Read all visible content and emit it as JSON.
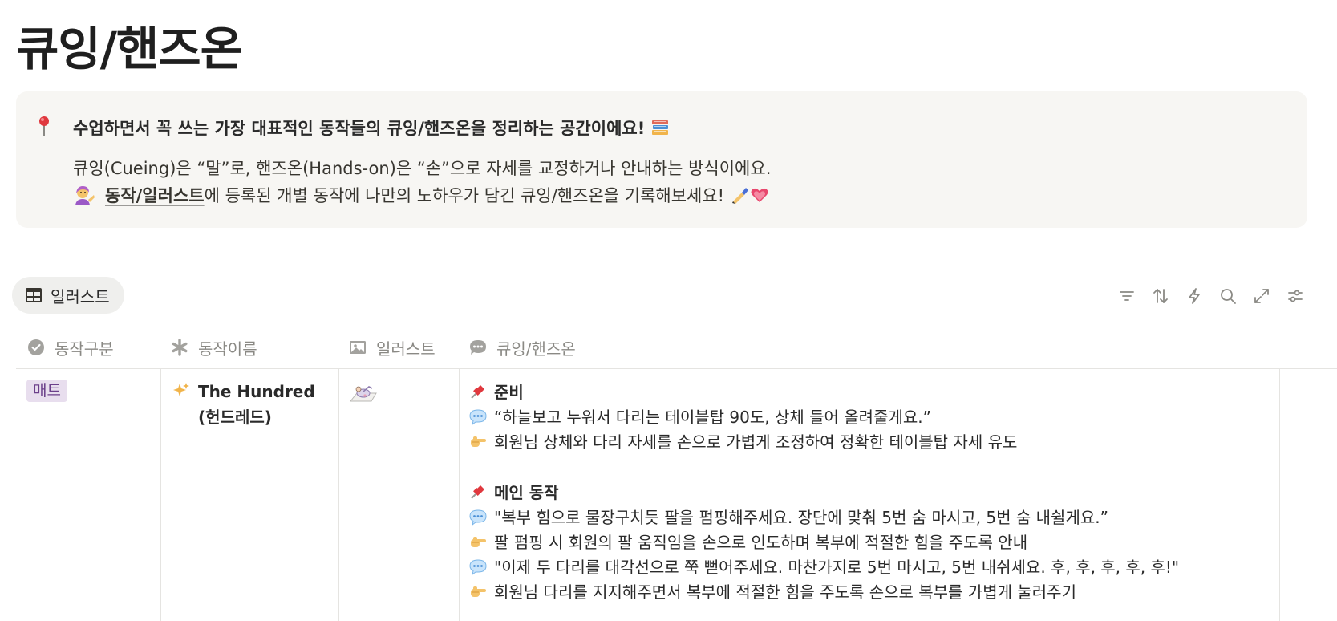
{
  "page": {
    "title": "큐잉/핸즈온"
  },
  "callout": {
    "pin_icon": "round-pushpin-icon",
    "headline": "수업하면서 꼭 쓰는 가장 대표적인 동작들의 큐잉/핸즈온을 정리하는 공간이에요!",
    "books_icon": "books-icon",
    "line2": "큐잉(Cueing)은 “말”로, 핸즈온(Hands-on)은 “손”으로 자세를 교정하거나 안내하는 방식이에요.",
    "line3_link": "동작/일러스트",
    "line3_rest": "에 등록된 개별 동작에 나만의 노하우가 담긴 큐잉/핸즈온을 기록해보세요!"
  },
  "view": {
    "tab_label": "일러스트",
    "tab_icon": "table-icon"
  },
  "toolbar": [
    "filter-icon",
    "sort-icon",
    "lightning-icon",
    "search-icon",
    "expand-icon",
    "settings-icon"
  ],
  "columns": [
    {
      "label": "동작구분",
      "icon": "status-check-icon"
    },
    {
      "label": "동작이름",
      "icon": "asterisk-icon"
    },
    {
      "label": "일러스트",
      "icon": "image-icon"
    },
    {
      "label": "큐잉/핸즈온",
      "icon": "comment-icon"
    }
  ],
  "row": {
    "category": "매트",
    "category_color": "#e8deee",
    "name_icon": "sparkles-icon",
    "name": "The Hundred (헌드레드)",
    "cue": {
      "section1_title": "준비",
      "s1_speech": "“하늘보고 누워서 다리는 테이블탑 90도, 상체 들어 올려줄게요.”",
      "s1_hand": "회원님 상체와 다리 자세를 손으로 가볍게 조정하여 정확한 테이블탑 자세 유도",
      "section2_title": "메인 동작",
      "s2_speech1": "\"복부 힘으로 물장구치듯 팔을 펌핑해주세요. 장단에 맞춰 5번 숨 마시고, 5번 숨 내쉴게요.”",
      "s2_hand1": "팔 펌핑 시 회원의 팔 움직임을 손으로 인도하며 복부에 적절한 힘을 주도록 안내",
      "s2_speech2": "\"이제 두 다리를 대각선으로 쭉 뻗어주세요. 마찬가지로 5번 마시고, 5번 내쉬세요. 후, 후, 후, 후, 후!\"",
      "s2_hand2": "회원님 다리를 지지해주면서 복부에 적절한 힘을 주도록 손으로 복부를 가볍게 눌러주기"
    }
  }
}
